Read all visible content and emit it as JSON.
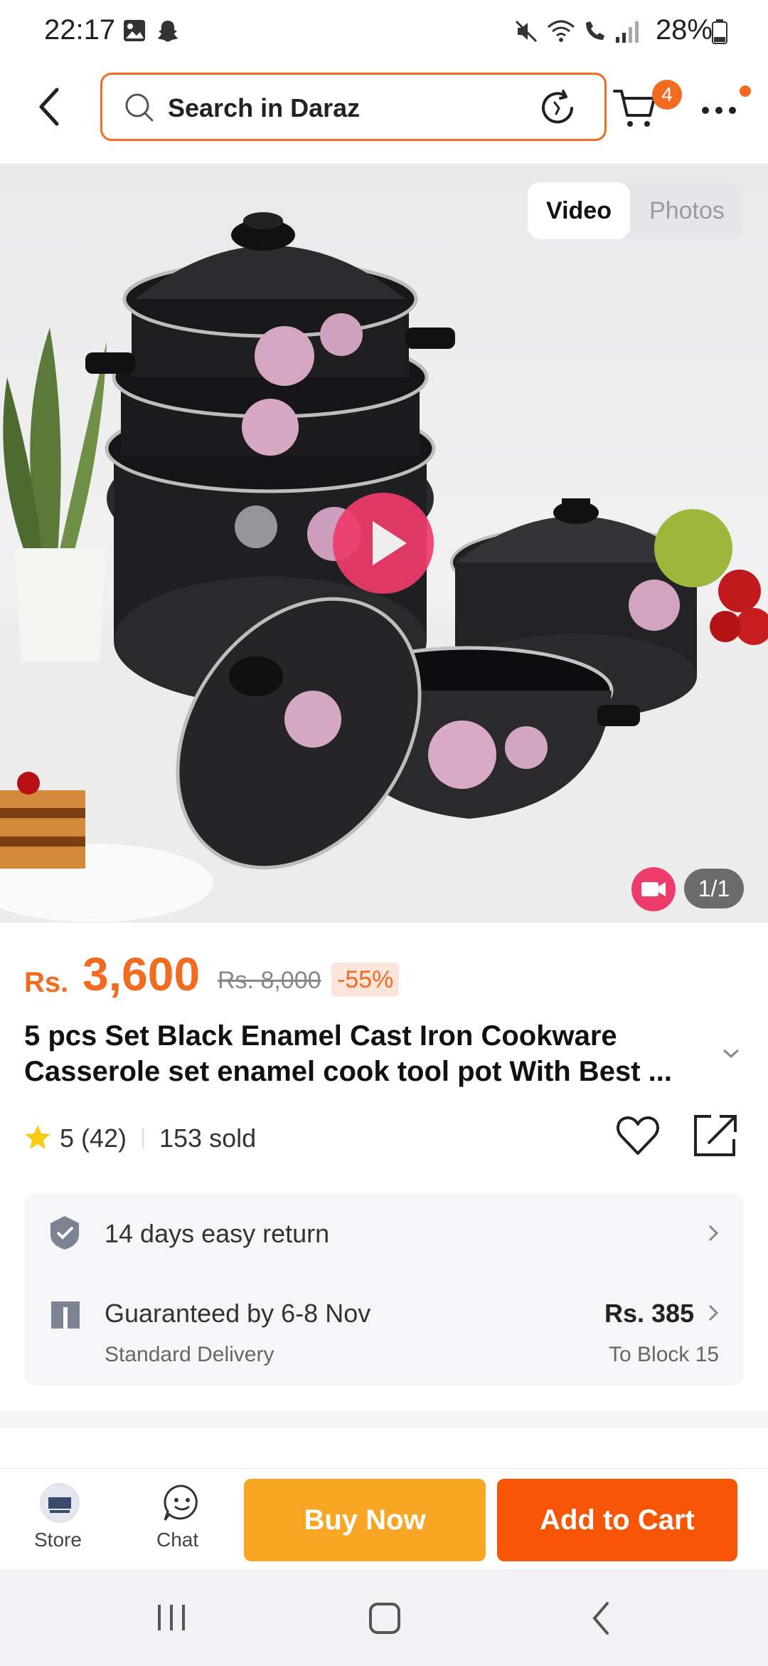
{
  "status_bar": {
    "time": "22:17",
    "battery": "28%",
    "icons": [
      "gallery-icon",
      "snapchat-icon",
      "mute-icon",
      "wifi-icon",
      "wifi-call-icon",
      "signal-icon",
      "battery-icon"
    ]
  },
  "header": {
    "search_placeholder": "Search in Daraz",
    "cart_count": "4"
  },
  "media": {
    "toggle_video": "Video",
    "toggle_photos": "Photos",
    "counter": "1/1"
  },
  "product": {
    "currency": "Rs.",
    "price": "3,600",
    "old_price": "Rs. 8,000",
    "discount": "-55%",
    "title": "5 pcs Set Black Enamel Cast Iron Cookware Casserole set enamel cook tool pot With Best ...",
    "rating": "5",
    "reviews": "(42)",
    "sold": "153 sold"
  },
  "services": {
    "return_text": "14 days easy return",
    "delivery_text": "Guaranteed by 6-8 Nov",
    "delivery_type": "Standard Delivery",
    "delivery_price": "Rs. 385",
    "delivery_location": "To Block 15"
  },
  "bottom_bar": {
    "store_label": "Store",
    "chat_label": "Chat",
    "buy_now": "Buy Now",
    "add_to_cart": "Add to Cart"
  },
  "colors": {
    "accent": "#f36b21",
    "buy_now": "#f8a623",
    "add_to_cart": "#f85606",
    "video_pink": "#ee3c6a"
  }
}
